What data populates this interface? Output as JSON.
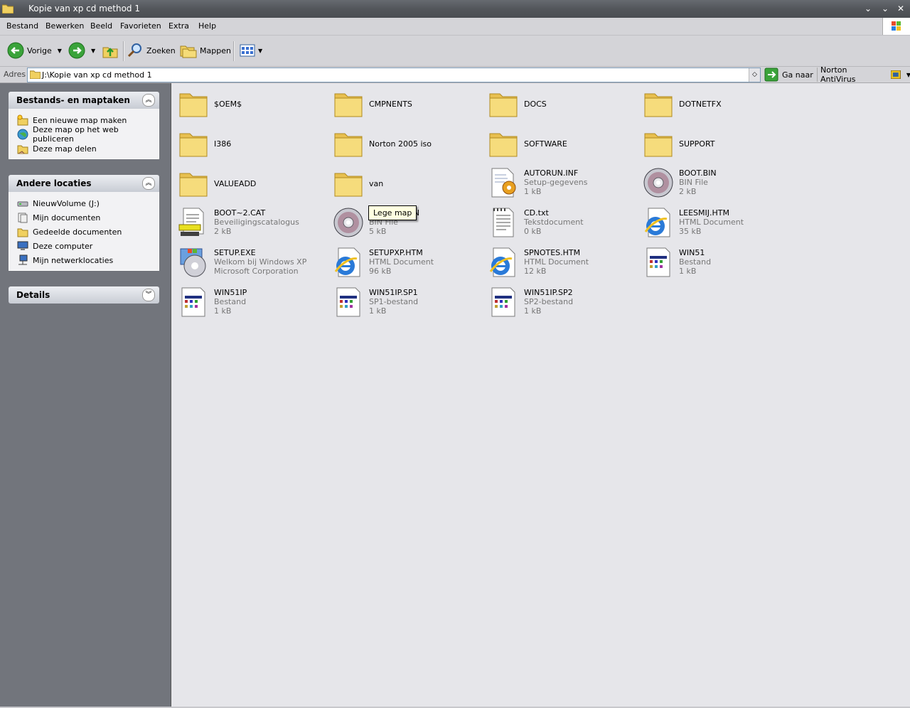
{
  "window": {
    "title": "Kopie van xp cd method 1"
  },
  "menu": [
    "Bestand",
    "Bewerken",
    "Beeld",
    "Favorieten",
    "Extra",
    "Help"
  ],
  "toolbar": {
    "back": "Vorige",
    "search": "Zoeken",
    "folders": "Mappen"
  },
  "address": {
    "label": "Adres",
    "path": "J:\\Kopie van xp cd method 1",
    "go": "Ga naar",
    "norton": "Norton AntiVirus"
  },
  "panels": {
    "tasks": {
      "title": "Bestands- en maptaken",
      "items": [
        "Een nieuwe map maken",
        "Deze map op het web publiceren",
        "Deze map delen"
      ]
    },
    "places": {
      "title": "Andere locaties",
      "items": [
        "NieuwVolume (J:)",
        "Mijn documenten",
        "Gedeelde documenten",
        "Deze computer",
        "Mijn netwerklocaties"
      ]
    },
    "details": {
      "title": "Details"
    }
  },
  "files": [
    {
      "name": "$OEM$",
      "type": "",
      "size": "",
      "icon": "folder"
    },
    {
      "name": "CMPNENTS",
      "type": "",
      "size": "",
      "icon": "folder"
    },
    {
      "name": "DOCS",
      "type": "",
      "size": "",
      "icon": "folder"
    },
    {
      "name": "DOTNETFX",
      "type": "",
      "size": "",
      "icon": "folder"
    },
    {
      "name": "I386",
      "type": "",
      "size": "",
      "icon": "folder"
    },
    {
      "name": "Norton 2005 iso",
      "type": "",
      "size": "",
      "icon": "folder"
    },
    {
      "name": "SOFTWARE",
      "type": "",
      "size": "",
      "icon": "folder"
    },
    {
      "name": "SUPPORT",
      "type": "",
      "size": "",
      "icon": "folder"
    },
    {
      "name": "VALUEADD",
      "type": "",
      "size": "",
      "icon": "folder"
    },
    {
      "name": "van",
      "type": "",
      "size": "",
      "icon": "folder"
    },
    {
      "name": "AUTORUN.INF",
      "type": "Setup-gegevens",
      "size": "1 kB",
      "icon": "setup-file"
    },
    {
      "name": "BOOT.BIN",
      "type": "BIN File",
      "size": "2 kB",
      "icon": "disc"
    },
    {
      "name": "BOOT~2.CAT",
      "type": "Beveiligingscatalogus",
      "size": "2 kB",
      "icon": "catalog"
    },
    {
      "name": "BOOTFIX.BIN",
      "type": "BIN File",
      "size": "5 kB",
      "icon": "disc"
    },
    {
      "name": "CD.txt",
      "type": "Tekstdocument",
      "size": "0 kB",
      "icon": "text-doc"
    },
    {
      "name": "LEESMIJ.HTM",
      "type": "HTML Document",
      "size": "35 kB",
      "icon": "ie"
    },
    {
      "name": "SETUP.EXE",
      "type": "Welkom bij Windows XP",
      "size": "Microsoft Corporation",
      "icon": "setup-exe"
    },
    {
      "name": "SETUPXP.HTM",
      "type": "HTML Document",
      "size": "96 kB",
      "icon": "ie"
    },
    {
      "name": "SPNOTES.HTM",
      "type": "HTML Document",
      "size": "12 kB",
      "icon": "ie"
    },
    {
      "name": "WIN51",
      "type": "Bestand",
      "size": "1 kB",
      "icon": "generic"
    },
    {
      "name": "WIN51IP",
      "type": "Bestand",
      "size": "1 kB",
      "icon": "generic"
    },
    {
      "name": "WIN51IP.SP1",
      "type": "SP1-bestand",
      "size": "1 kB",
      "icon": "generic"
    },
    {
      "name": "WIN51IP.SP2",
      "type": "SP2-bestand",
      "size": "1 kB",
      "icon": "generic"
    }
  ],
  "tooltip": "Lege map"
}
